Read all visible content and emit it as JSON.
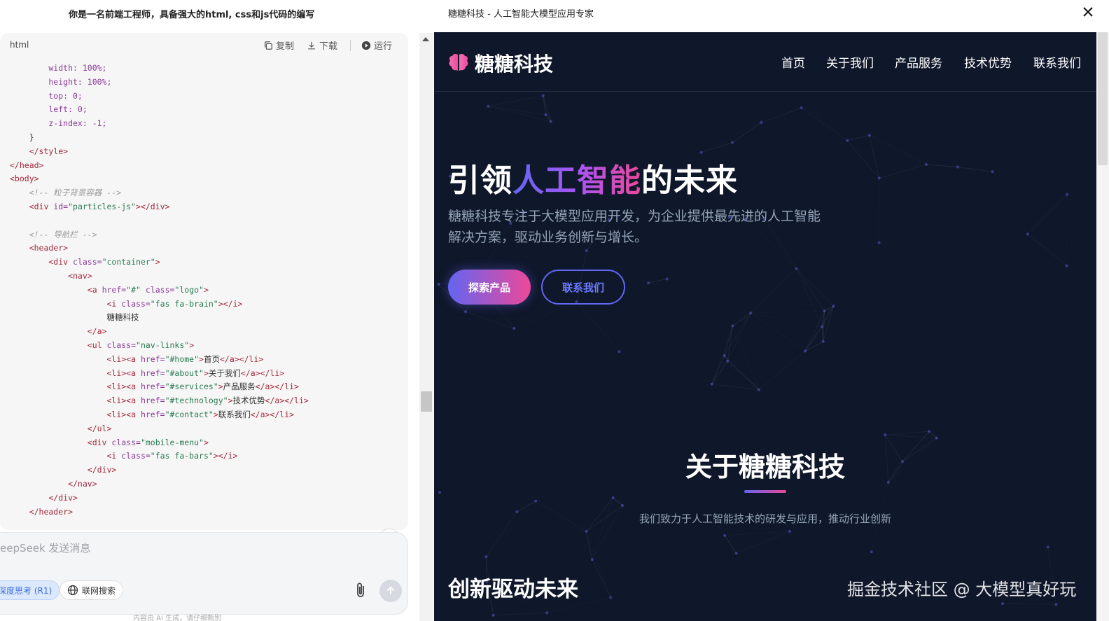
{
  "chat": {
    "prompt": "你是一名前端工程师，具备强大的html, css和js代码的编写",
    "code_block": {
      "language": "html",
      "actions": {
        "copy": "复制",
        "download": "下载",
        "run": "运行"
      },
      "lines": [
        [
          [
            "t-attr",
            "        width: 100%;"
          ]
        ],
        [
          [
            "t-attr",
            "        height: 100%;"
          ]
        ],
        [
          [
            "t-attr",
            "        top: 0;"
          ]
        ],
        [
          [
            "t-attr",
            "        left: 0;"
          ]
        ],
        [
          [
            "t-attr",
            "        z-index: -1;"
          ]
        ],
        [
          [
            "t-txt",
            "    }"
          ]
        ],
        [
          [
            "t-tag",
            "    </style>"
          ]
        ],
        [
          [
            "t-tag",
            "</head>"
          ]
        ],
        [
          [
            "t-tag",
            "<body>"
          ]
        ],
        [
          [
            "t-com",
            "    <!-- 粒子背景容器 -->"
          ]
        ],
        [
          [
            "t-tag",
            "    <div "
          ],
          [
            "t-attr",
            "id="
          ],
          [
            "t-str",
            "\"particles-js\""
          ],
          [
            "t-tag",
            "></div>"
          ]
        ],
        [
          [
            "t-txt",
            ""
          ]
        ],
        [
          [
            "t-com",
            "    <!-- 导航栏 -->"
          ]
        ],
        [
          [
            "t-tag",
            "    <header>"
          ]
        ],
        [
          [
            "t-tag",
            "        <div "
          ],
          [
            "t-attr",
            "class="
          ],
          [
            "t-str",
            "\"container\""
          ],
          [
            "t-tag",
            ">"
          ]
        ],
        [
          [
            "t-tag",
            "            <nav>"
          ]
        ],
        [
          [
            "t-tag",
            "                <a "
          ],
          [
            "t-attr",
            "href="
          ],
          [
            "t-str",
            "\"#\""
          ],
          [
            "t-attr",
            " class="
          ],
          [
            "t-str",
            "\"logo\""
          ],
          [
            "t-tag",
            ">"
          ]
        ],
        [
          [
            "t-tag",
            "                    <i "
          ],
          [
            "t-attr",
            "class="
          ],
          [
            "t-str",
            "\"fas fa-brain\""
          ],
          [
            "t-tag",
            "></i>"
          ]
        ],
        [
          [
            "t-txt",
            "                    糖糖科技"
          ]
        ],
        [
          [
            "t-tag",
            "                </a>"
          ]
        ],
        [
          [
            "t-tag",
            "                <ul "
          ],
          [
            "t-attr",
            "class="
          ],
          [
            "t-str",
            "\"nav-links\""
          ],
          [
            "t-tag",
            ">"
          ]
        ],
        [
          [
            "t-tag",
            "                    <li><a "
          ],
          [
            "t-attr",
            "href="
          ],
          [
            "t-str",
            "\"#home\""
          ],
          [
            "t-tag",
            ">"
          ],
          [
            "t-txt",
            "首页"
          ],
          [
            "t-tag",
            "</a></li>"
          ]
        ],
        [
          [
            "t-tag",
            "                    <li><a "
          ],
          [
            "t-attr",
            "href="
          ],
          [
            "t-str",
            "\"#about\""
          ],
          [
            "t-tag",
            ">"
          ],
          [
            "t-txt",
            "关于我们"
          ],
          [
            "t-tag",
            "</a></li>"
          ]
        ],
        [
          [
            "t-tag",
            "                    <li><a "
          ],
          [
            "t-attr",
            "href="
          ],
          [
            "t-str",
            "\"#services\""
          ],
          [
            "t-tag",
            ">"
          ],
          [
            "t-txt",
            "产品服务"
          ],
          [
            "t-tag",
            "</a></li>"
          ]
        ],
        [
          [
            "t-tag",
            "                    <li><a "
          ],
          [
            "t-attr",
            "href="
          ],
          [
            "t-str",
            "\"#technology\""
          ],
          [
            "t-tag",
            ">"
          ],
          [
            "t-txt",
            "技术优势"
          ],
          [
            "t-tag",
            "</a></li>"
          ]
        ],
        [
          [
            "t-tag",
            "                    <li><a "
          ],
          [
            "t-attr",
            "href="
          ],
          [
            "t-str",
            "\"#contact\""
          ],
          [
            "t-tag",
            ">"
          ],
          [
            "t-txt",
            "联系我们"
          ],
          [
            "t-tag",
            "</a></li>"
          ]
        ],
        [
          [
            "t-tag",
            "                </ul>"
          ]
        ],
        [
          [
            "t-tag",
            "                <div "
          ],
          [
            "t-attr",
            "class="
          ],
          [
            "t-str",
            "\"mobile-menu\""
          ],
          [
            "t-tag",
            ">"
          ]
        ],
        [
          [
            "t-tag",
            "                    <i "
          ],
          [
            "t-attr",
            "class="
          ],
          [
            "t-str",
            "\"fas fa-bars\""
          ],
          [
            "t-tag",
            "></i>"
          ]
        ],
        [
          [
            "t-tag",
            "                </div>"
          ]
        ],
        [
          [
            "t-tag",
            "            </nav>"
          ]
        ],
        [
          [
            "t-tag",
            "        </div>"
          ]
        ],
        [
          [
            "t-tag",
            "    </header>"
          ]
        ]
      ]
    },
    "input_placeholder": "eepSeek 发送消息",
    "deep_think_label": "深度思考 (R1)",
    "web_search_label": "联网搜索",
    "footnote": "内容由 AI 生成，请仔细甄别"
  },
  "preview": {
    "window_title": "糖糖科技 - 人工智能大模型应用专家",
    "site": {
      "logo_text": "糖糖科技",
      "nav": [
        "首页",
        "关于我们",
        "产品服务",
        "技术优势",
        "联系我们"
      ],
      "hero_title_pre": "引领",
      "hero_title_grad": "人工智能",
      "hero_title_post": "的未来",
      "hero_desc": "糖糖科技专注于大模型应用开发，为企业提供最先进的人工智能解决方案，驱动业务创新与增长。",
      "btn_primary": "探索产品",
      "btn_secondary": "联系我们",
      "about_title": "关于糖糖科技",
      "about_sub": "我们致力于人工智能技术的研发与应用，推动行业创新",
      "section_title": "创新驱动未来"
    },
    "watermark": "掘金技术社区 @ 大模型真好玩"
  },
  "colors": {
    "site_bg": "#0f172a",
    "accent_indigo": "#6366f1",
    "accent_pink": "#ec4899",
    "muted_text": "#94a3b8"
  }
}
